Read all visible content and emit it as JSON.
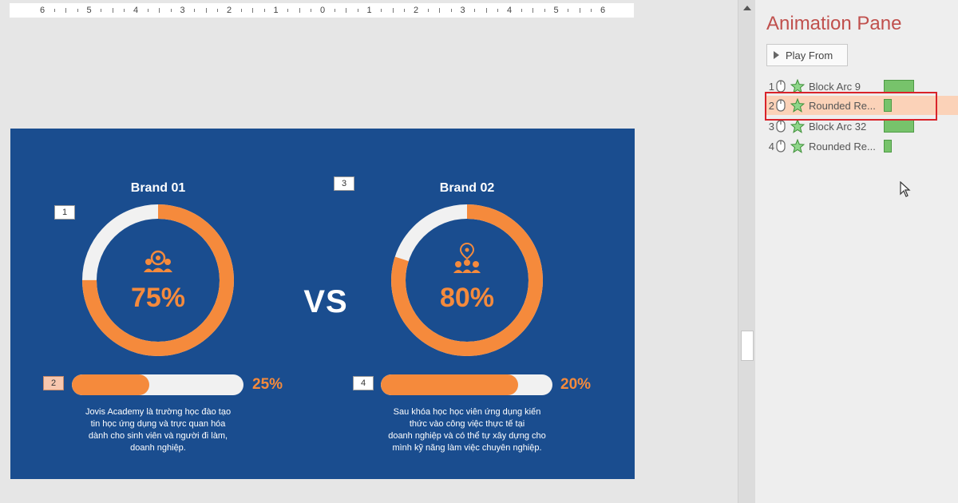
{
  "ruler": {
    "numbers": [
      "6",
      "5",
      "4",
      "3",
      "2",
      "1",
      "0",
      "1",
      "2",
      "3",
      "4",
      "5",
      "6"
    ]
  },
  "slide": {
    "brand1": {
      "title": "Brand 01",
      "donut_value": "75%",
      "donut_percent": 75,
      "bar_value": "25%",
      "bar_percent": 45,
      "description": [
        "Jovis Academy là trường học đào tạo",
        "tin học ứng dụng và trực quan hóa",
        "dành cho sinh viên và người đi làm,",
        "doanh nghiệp."
      ],
      "icon": "team-icon"
    },
    "brand2": {
      "title": "Brand 02",
      "donut_value": "80%",
      "donut_percent": 80,
      "bar_value": "20%",
      "bar_percent": 80,
      "description": [
        "Sau khóa học học viên ứng dụng kiến",
        "thức vào công việc thực tế tại",
        "doanh nghiệp và có thể tự xây dựng cho",
        "mình kỹ năng làm việc chuyên nghiệp."
      ],
      "icon": "location-team-icon"
    },
    "vs": "VS",
    "tags": [
      "1",
      "2",
      "3",
      "4"
    ],
    "colors": {
      "background": "#1a4d8f",
      "accent": "#f58a3c",
      "track": "#f1f1f1"
    }
  },
  "pane": {
    "title": "Animation Pane",
    "play_label": "Play From",
    "items": [
      {
        "num": "1",
        "name": "Block Arc 9",
        "bar": 38
      },
      {
        "num": "2",
        "name": "Rounded Re...",
        "bar": 10
      },
      {
        "num": "3",
        "name": "Block Arc 32",
        "bar": 38
      },
      {
        "num": "4",
        "name": "Rounded Re...",
        "bar": 10
      }
    ],
    "selected_index": 1
  }
}
